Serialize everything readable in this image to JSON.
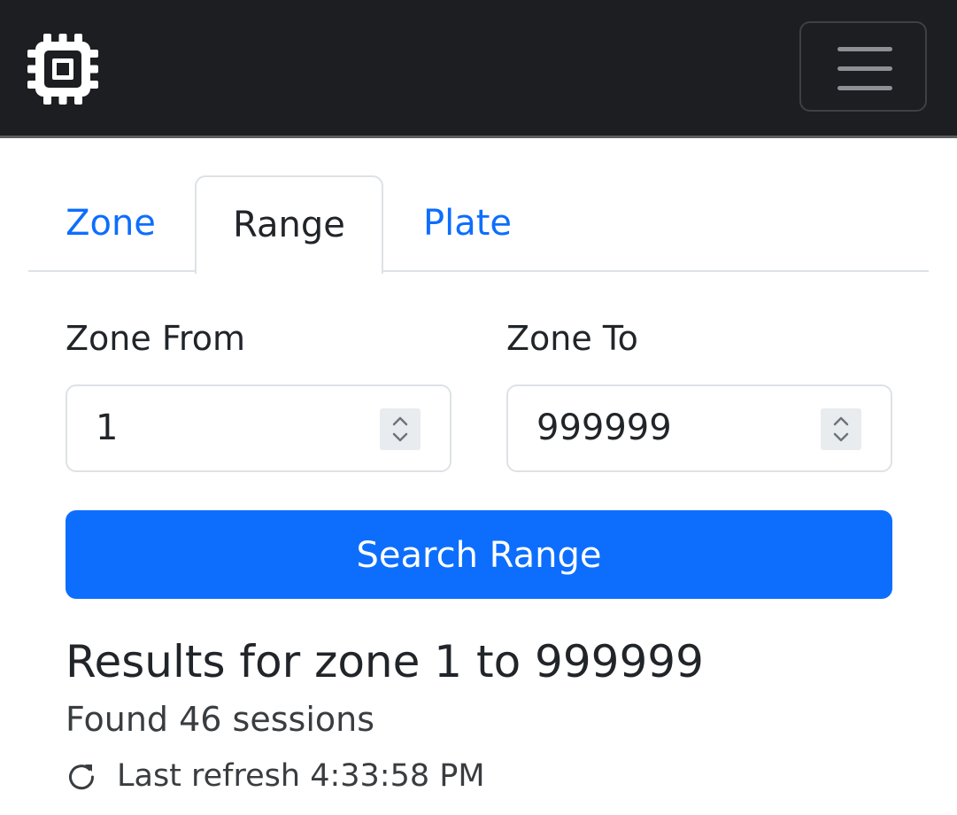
{
  "navbar": {
    "brand_icon": "cpu-chip-icon",
    "menu_icon": "hamburger-menu-icon",
    "background": "#1d1e21"
  },
  "tabs": [
    {
      "label": "Zone",
      "active": false
    },
    {
      "label": "Range",
      "active": true
    },
    {
      "label": "Plate",
      "active": false
    }
  ],
  "form": {
    "zone_from": {
      "label": "Zone From",
      "value": "1"
    },
    "zone_to": {
      "label": "Zone To",
      "value": "999999"
    },
    "search_button": "Search Range"
  },
  "results": {
    "title": "Results for zone 1 to 999999",
    "count_text": "Found 46 sessions",
    "refresh_icon": "refresh-icon",
    "last_refresh": "Last refresh 4:33:58 PM"
  },
  "colors": {
    "primary": "#0d6efd",
    "text": "#212529",
    "border": "#dee2e6"
  }
}
